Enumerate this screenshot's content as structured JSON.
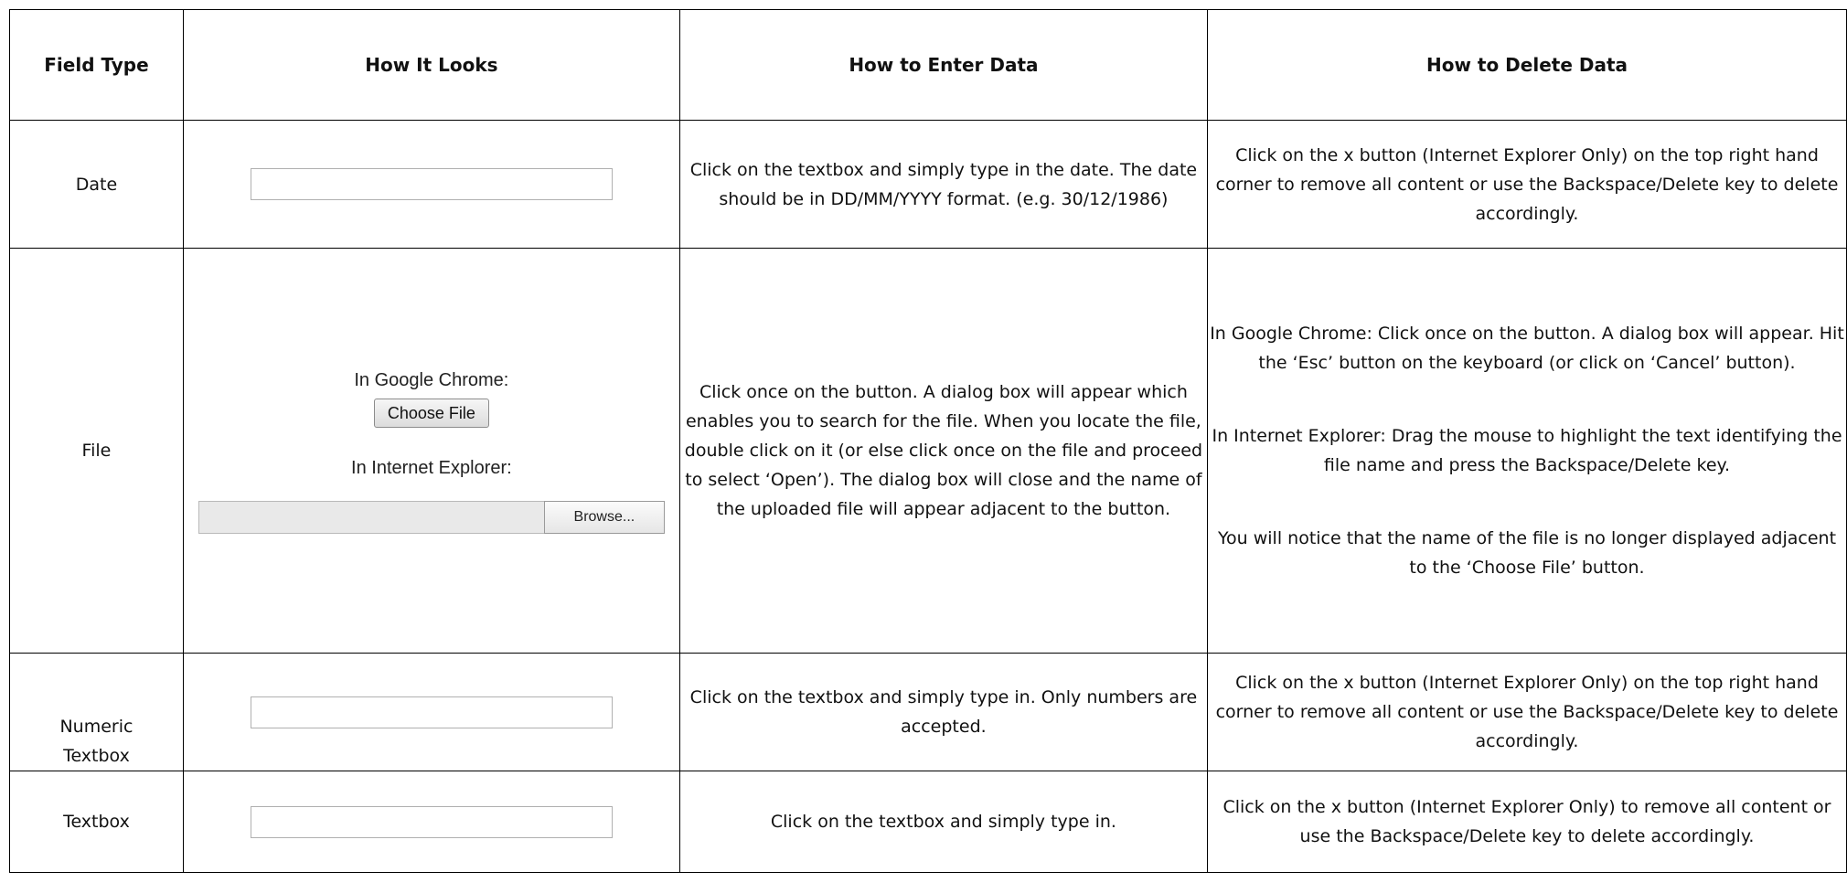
{
  "headers": {
    "field_type": "Field Type",
    "how_it_looks": "How It Looks",
    "how_to_enter": "How to Enter Data",
    "how_to_delete": "How to Delete Data"
  },
  "rows": [
    {
      "field_type": "Date",
      "enter": "Click on the textbox and simply type in the date. The date should be in DD/MM/YYYY format. (e.g. 30/12/1986)",
      "delete": "Click on the x button (Internet Explorer Only) on the top right hand corner to remove all content or use the Backspace/Delete key to delete accordingly."
    },
    {
      "field_type": "File",
      "chrome_label": "In Google Chrome:",
      "chrome_button": "Choose File",
      "ie_label": "In Internet Explorer:",
      "ie_button": "Browse...",
      "enter": "Click once on the button. A dialog box will appear which enables you to search for the file. When you locate the file, double click on it (or else click once on the file and proceed to select ‘Open’). The dialog box will close and the name of the uploaded file will appear adjacent to the button.",
      "delete_chrome": "In Google Chrome: Click once on the button. A dialog box will appear.  Hit the ‘Esc’ button on the keyboard (or click on ‘Cancel’ button).",
      "delete_ie": "In Internet Explorer: Drag the mouse to highlight the text identifying the file name and press the Backspace/Delete key.",
      "delete_note": "You will notice that the name of the file is no longer displayed adjacent to the ‘Choose File’ button."
    },
    {
      "field_type": "Numeric Textbox",
      "enter": "Click on the textbox and simply type in. Only numbers are accepted.",
      "delete": "Click on the x button (Internet Explorer Only) on the top right hand corner to remove all content or use the Backspace/Delete key to delete accordingly."
    },
    {
      "field_type": "Textbox",
      "enter": "Click on the textbox and simply type in.",
      "delete": "Click on the x button (Internet Explorer Only) to remove all content or use the Backspace/Delete key to delete accordingly."
    }
  ]
}
